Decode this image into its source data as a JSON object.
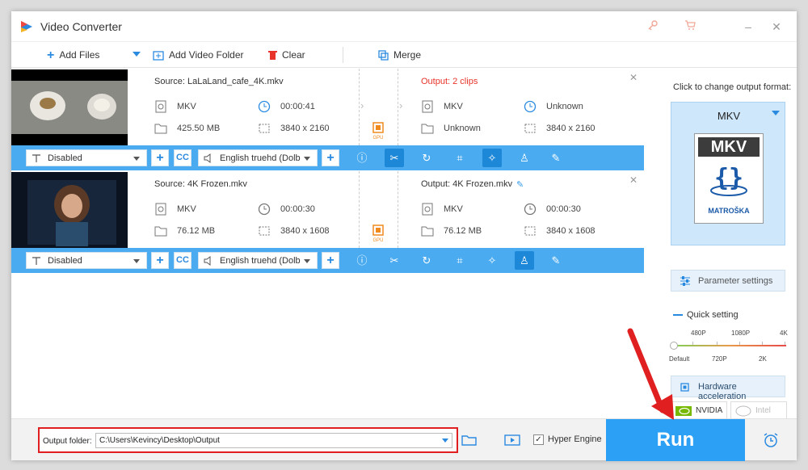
{
  "window": {
    "title": "Video Converter"
  },
  "toolbar": {
    "add_files": "Add Files",
    "add_video_folder": "Add Video Folder",
    "clear": "Clear",
    "merge": "Merge"
  },
  "items": [
    {
      "source": "Source: LaLaLand_cafe_4K.mkv",
      "output": "Output: 2 clips",
      "src_format": "MKV",
      "src_duration": "00:00:41",
      "src_size": "425.50 MB",
      "src_resolution": "3840 x 2160",
      "out_format": "MKV",
      "out_duration": "Unknown",
      "out_size": "Unknown",
      "out_resolution": "3840 x 2160",
      "subtitle": "Disabled",
      "audio": "English truehd (Dolb"
    },
    {
      "source": "Source: 4K Frozen.mkv",
      "output": "Output: 4K Frozen.mkv",
      "src_format": "MKV",
      "src_duration": "00:00:30",
      "src_size": "76.12 MB",
      "src_resolution": "3840 x 1608",
      "out_format": "MKV",
      "out_duration": "00:00:30",
      "out_size": "76.12 MB",
      "out_resolution": "3840 x 1608",
      "subtitle": "Disabled",
      "audio": "English truehd (Dolb"
    }
  ],
  "gpu_label": "GPU",
  "right_panel": {
    "label": "Click to change output format:",
    "format": "MKV",
    "format_logo": "MKV",
    "format_logo_sub": "MATROŠKA",
    "parameter_settings": "Parameter settings",
    "quick_setting": "Quick setting",
    "quality_top": [
      "480P",
      "1080P",
      "4K"
    ],
    "quality_bottom": [
      "Default",
      "720P",
      "2K"
    ],
    "hardware_acceleration": "Hardware acceleration",
    "nvidia": "NVIDIA",
    "intel": "Intel"
  },
  "bottom": {
    "output_folder_label": "Output folder:",
    "output_path": "C:\\Users\\Kevincy\\Desktop\\Output",
    "hyper_engine": "Hyper Engine",
    "run": "Run"
  },
  "colors": {
    "accent": "#2ba0f5",
    "highlight": "#e02020",
    "output_red": "#e8332a"
  }
}
